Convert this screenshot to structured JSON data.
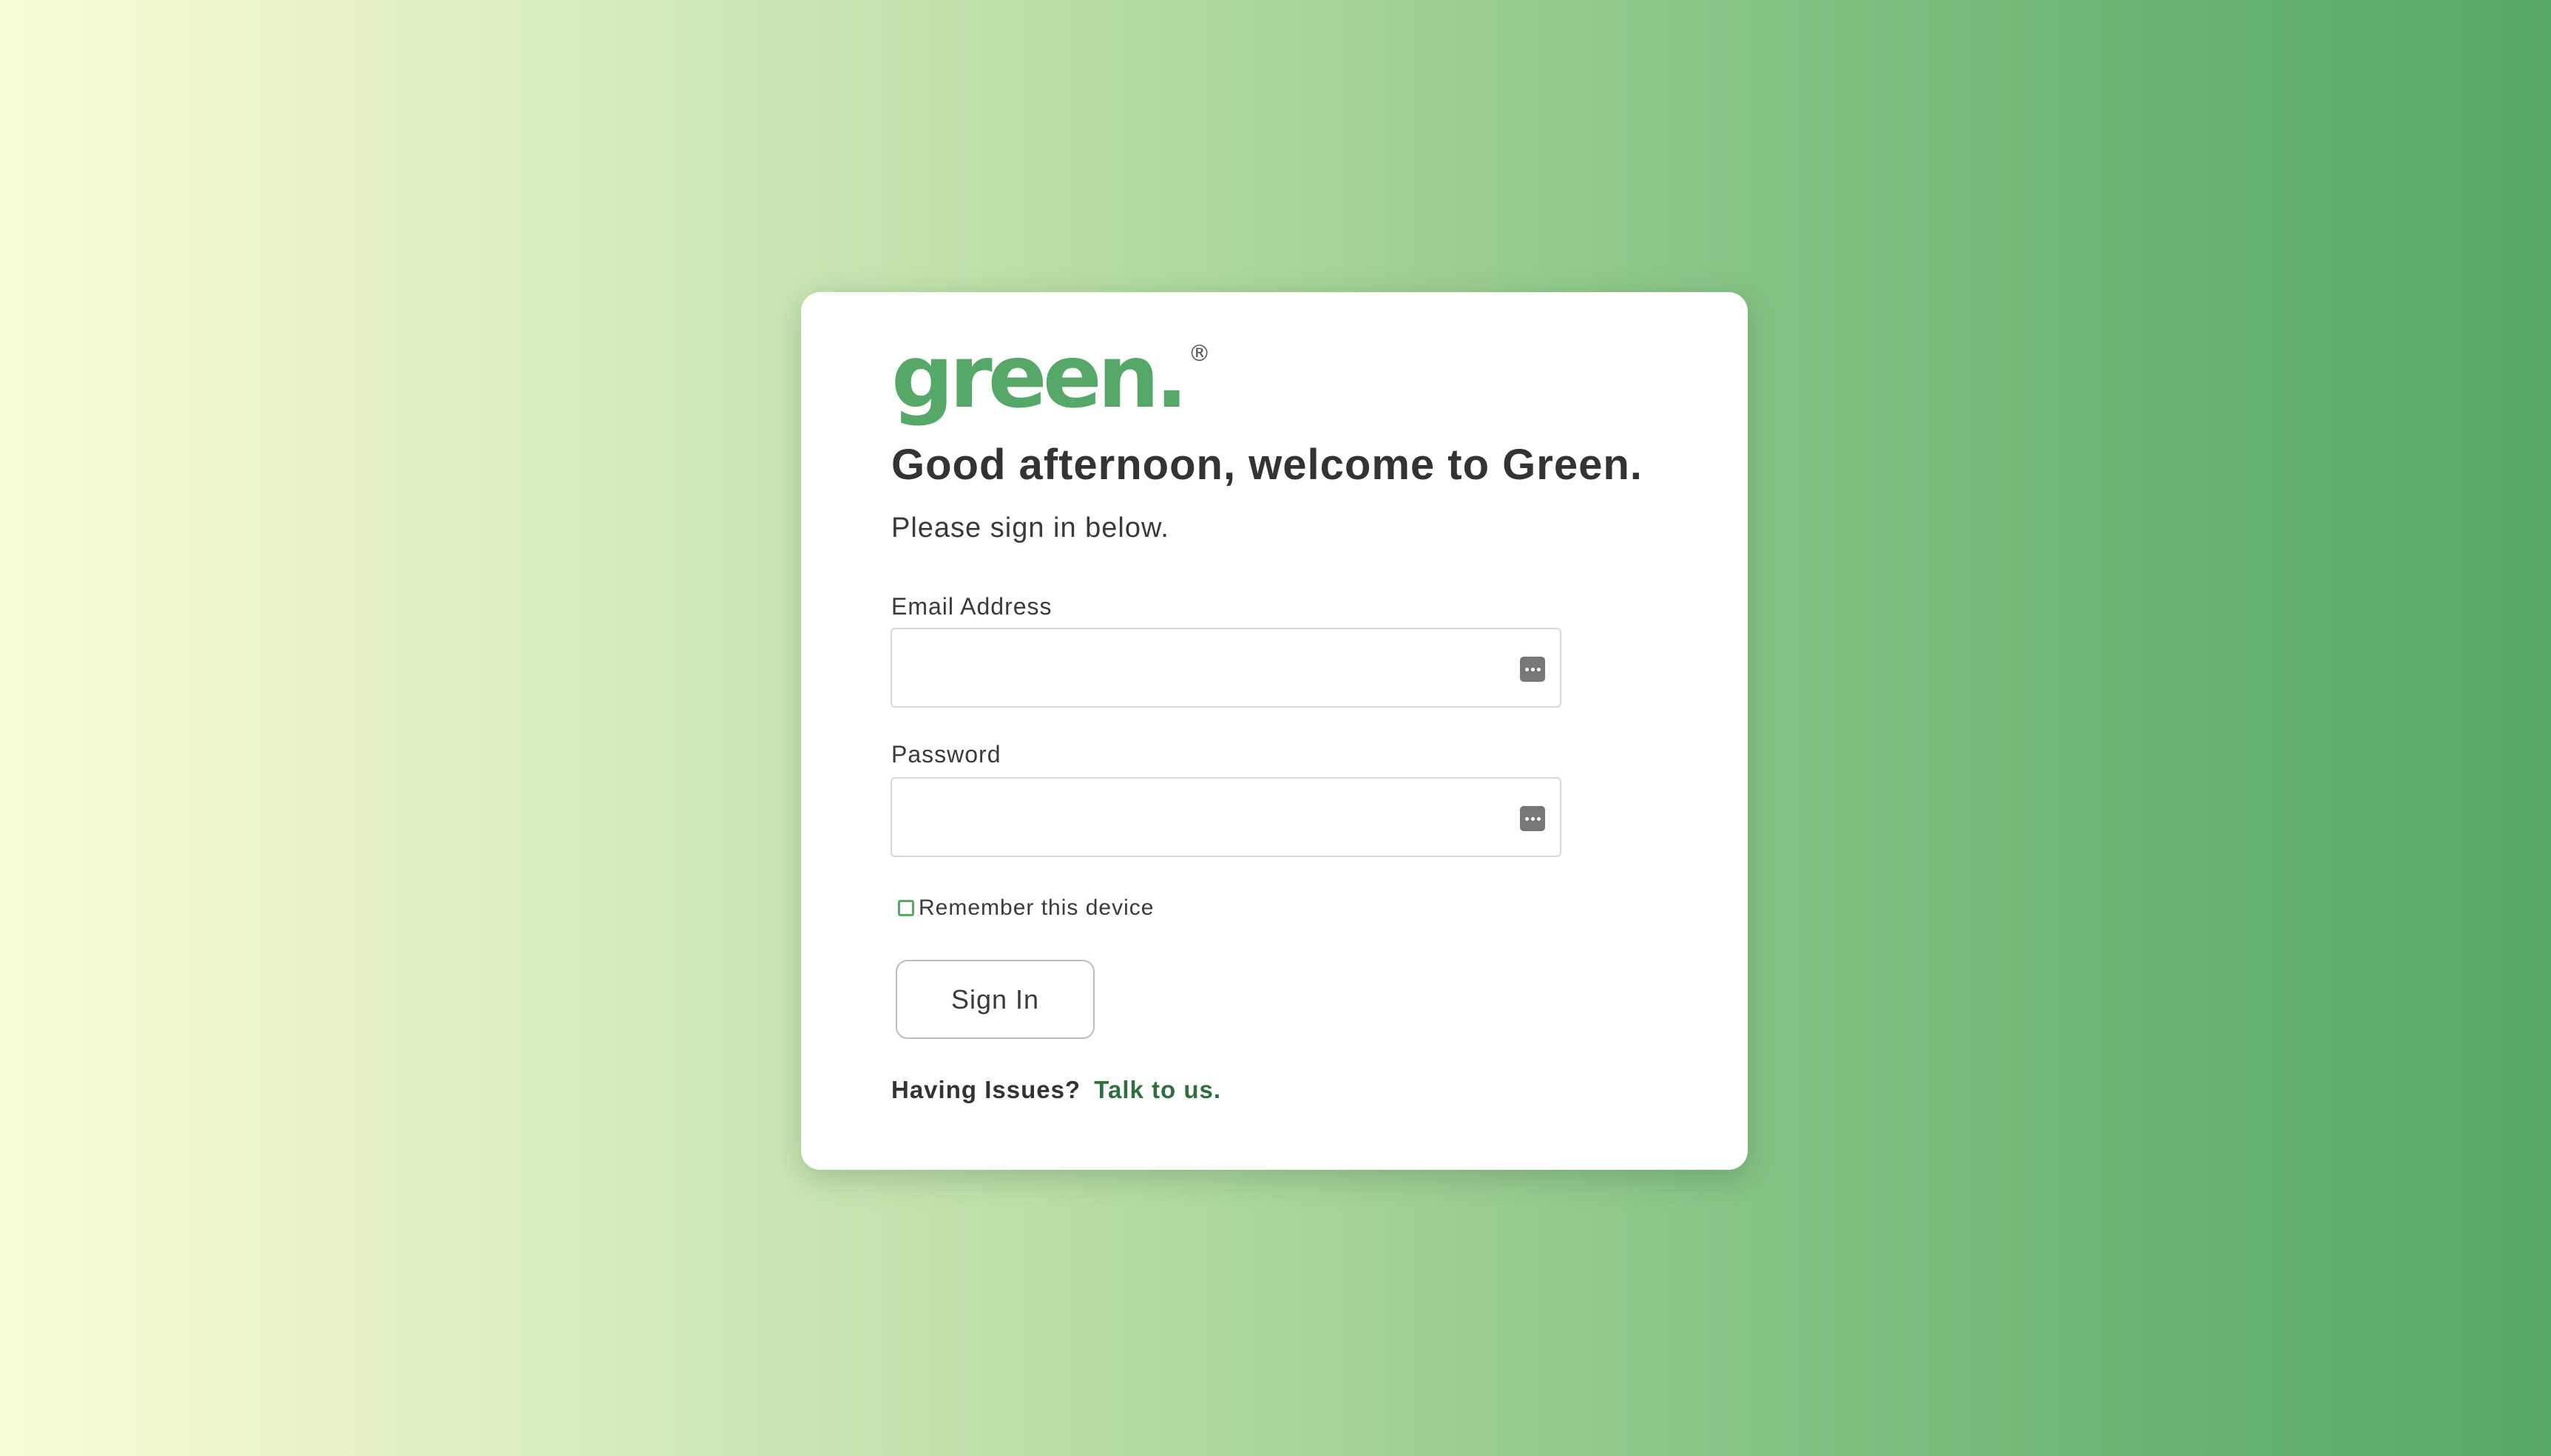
{
  "brand": {
    "logo_text": "green.",
    "registered_mark": "®",
    "color": "#55a868"
  },
  "login": {
    "greeting": "Good afternoon, welcome to Green.",
    "subtitle": "Please sign in below.",
    "email": {
      "label": "Email Address",
      "value": "",
      "placeholder": "",
      "icon": "password-manager-icon"
    },
    "password": {
      "label": "Password",
      "value": "",
      "placeholder": "",
      "icon": "password-manager-icon"
    },
    "remember": {
      "label": "Remember this device",
      "checked": false
    },
    "signin_label": "Sign In",
    "help_text": "Having Issues?",
    "help_link": "Talk to us.",
    "link_color": "#2f6f3e"
  }
}
